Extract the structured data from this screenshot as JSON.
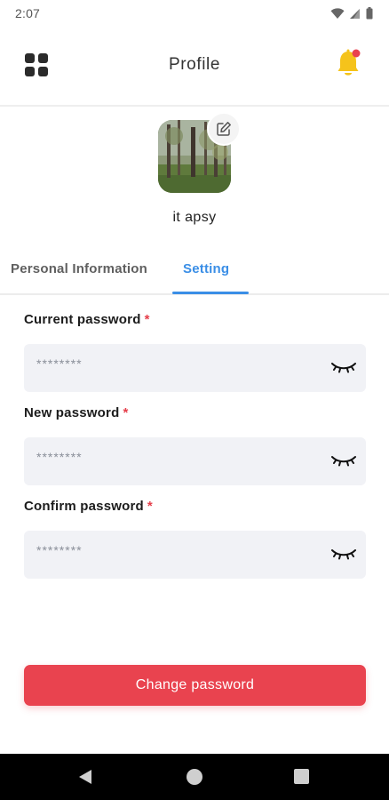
{
  "status_bar": {
    "time": "2:07"
  },
  "header": {
    "title": "Profile",
    "bell_color": "#f5c31b",
    "badge_color": "#e9434f"
  },
  "profile": {
    "username": "it apsy"
  },
  "tabs": [
    {
      "label": "Personal Information",
      "active": false
    },
    {
      "label": "Setting",
      "active": true
    }
  ],
  "form": {
    "fields": [
      {
        "label": "Current password",
        "required_mark": "*",
        "value": "********"
      },
      {
        "label": "New password",
        "required_mark": "*",
        "value": "********"
      },
      {
        "label": "Confirm password",
        "required_mark": "*",
        "value": "********"
      }
    ],
    "submit_label": "Change password"
  },
  "colors": {
    "accent": "#3a8ee6",
    "danger": "#e9434f",
    "input_bg": "#f1f2f6"
  }
}
